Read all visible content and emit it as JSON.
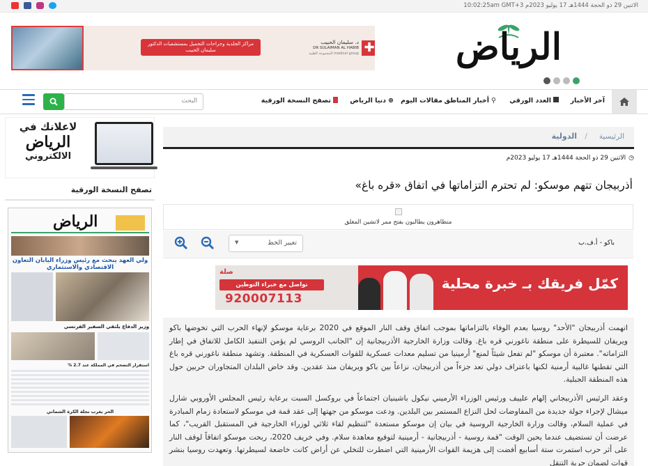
{
  "topbar": {
    "datetime": "الاثنين 29 ذو الحجة 1444هـ 17 يوليو 2023م 10:02:25am GMT+3",
    "social": [
      "twitter-icon",
      "facebook-icon",
      "instagram-icon",
      "youtube-icon"
    ]
  },
  "header": {
    "logo_text": "الرياض",
    "ad_banner_text": "مراكز الجلدية وجراحات التجميل بمستشفيات الدكتور سليمان الحبيب",
    "ad_brand_ar": "د. سليمان الحبيب",
    "ad_brand_en": "DR SULAIMAN AL HABIB",
    "ad_brand_sub": "medical group المجموعة الطبية"
  },
  "nav": {
    "items": [
      "آخر الأخبار",
      "العدد الورقي",
      "أخبار المناطق",
      "مقالات اليوم",
      "دنيا الرياض",
      "تصفح النسخة الورقية"
    ],
    "search_placeholder": "البحث"
  },
  "sidebar": {
    "ad_line1": "لاعلانك في",
    "ad_line2": "الرياض",
    "ad_line3": "الالكتروني",
    "title": "تصفح النسخة الورقية",
    "paper": {
      "masthead": "الرياض",
      "headline1": "ولي العهد يبحث مع رئيس وزراء اليابان التعاون الاقتصادي والاستثماري",
      "headline2": "وزير الدفاع يلتقي السفير الفرنسي",
      "headline3": "استقرار التضخم في المملكة عند 2.7 %",
      "headline4": "الحر يغرب نجلة الكرة الشماني"
    }
  },
  "article": {
    "breadcrumb_home": "الرئيسية",
    "breadcrumb_sep": "/",
    "breadcrumb_cat": "الدولية",
    "date": "الاثنين 29 ذو الحجة 1444هـ 17 يوليو 2023م",
    "headline": "أذربيجان تتهم موسكو: لم تحترم التزاماتها في اتفاق «قره باغ»",
    "image_caption": "متظاهرون يطالبون بفتح ممر لاتشين المغلق",
    "byline": "باكو - أ.ف.ب",
    "font_select": "تغيير الخط",
    "paragraphs": [
      "اتهمت أذربيجان \"الأحد\" روسيا بعدم الوفاء بالتزاماتها بموجب اتفاق وقف النار الموقع في 2020 برعاية موسكو لإنهاء الحرب التي تخوضها باكو ويريفان للسيطرة على منطقة ناغورني قره باغ. وقالت وزارة الخارجية الأذربيجانية إن \"الجانب الروسي لم يؤمن التنفيذ الكامل للاتفاق في إطار التزاماته\". معتبرة أن موسكو \"لم تفعل شيئاً لمنع\" أرمينيا من تسليم معدات عسكرية للقوات العسكرية في المنطقة. وتشهد منطقة ناغورني قره باغ التي تقطنها غالبية أرمنية لكنها باعتراف دولي تعد جزءاً من أذربيجان، نزاعاً بين باكو ويريفان منذ عقدين. وقد خاض البلدان المتجاوران حربين حول هذه المنطقة الجبلية.",
      "وعقد الرئيس الأذربيجاني إلهام علييف ورئيس الوزراء الأرميني نيكول باشينيان اجتماعاً في بروكسل السبت برعاية رئيس المجلس الأوروبي شارل ميشال لإجراء جولة جديدة من المفاوضات لحل النزاع المستمر بين البلدين. ودعت موسكو من جهتها إلى عقد قمة في موسكو لاستعادة زمام المبادرة في عملية السلام، وقالت وزارة الخارجية الروسية في بيان إن موسكو مستعدة \"لتنظيم لقاء ثلاثي لوزراء الخارجية في المستقبل القريب\"، كما عرضت أن تستضيف عندما يحين الوقت \"قمة روسية - أذربيجانية - أرمينية لتوقيع معاهدة سلام. وفي خريف 2020، ربحت موسكو اتفاقاً لوقف النار على أثر حرب استمرت ستة أسابيع أفضت إلى هزيمة القوات الأرمينية التي اضطرت للتخلي عن أراض كانت خاضعة لسيطرتها. وتعهدت روسيا بنشر قوات لضمان حرية التنقل"
    ]
  },
  "ad2": {
    "text": "كمّل فريقك بـ خبرة محلية",
    "pill": "تواصل مع خبراء التوطين",
    "phone": "920007113",
    "brand": "صلة"
  },
  "colors": {
    "green": "#2db24a",
    "red": "#d4343a",
    "blue": "#2a6ab8",
    "logo_green": "#3aa36a"
  }
}
